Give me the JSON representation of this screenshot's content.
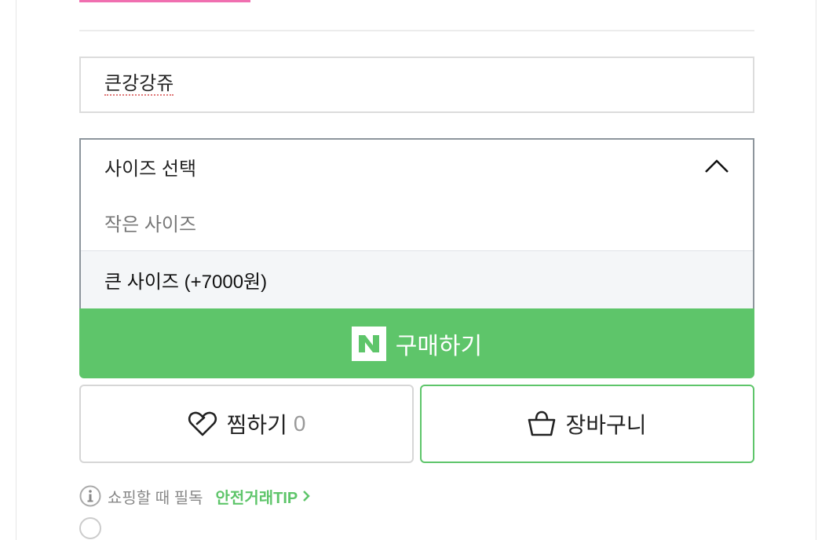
{
  "product_option": {
    "text_input_value": "큰강강쥬",
    "select": {
      "label": "사이즈 선택",
      "expanded": true,
      "options": [
        {
          "label": "작은 사이즈",
          "state": "disabled"
        },
        {
          "label": "큰 사이즈 (+7000원)",
          "state": "hover"
        }
      ]
    }
  },
  "actions": {
    "buy_label": "구매하기",
    "wish_label": "찜하기",
    "wish_count": "0",
    "cart_label": "장바구니"
  },
  "tip": {
    "text": "쇼핑할 때 필독",
    "link_label": "안전거래TIP"
  },
  "colors": {
    "accent_green": "#5ec56a",
    "pink_bar": "#f06fb0",
    "select_border": "#8d959c"
  },
  "icons": [
    "chevron-up-icon",
    "naver-n-logo",
    "heart-icon",
    "basket-icon",
    "info-icon",
    "chevron-right-icon"
  ]
}
